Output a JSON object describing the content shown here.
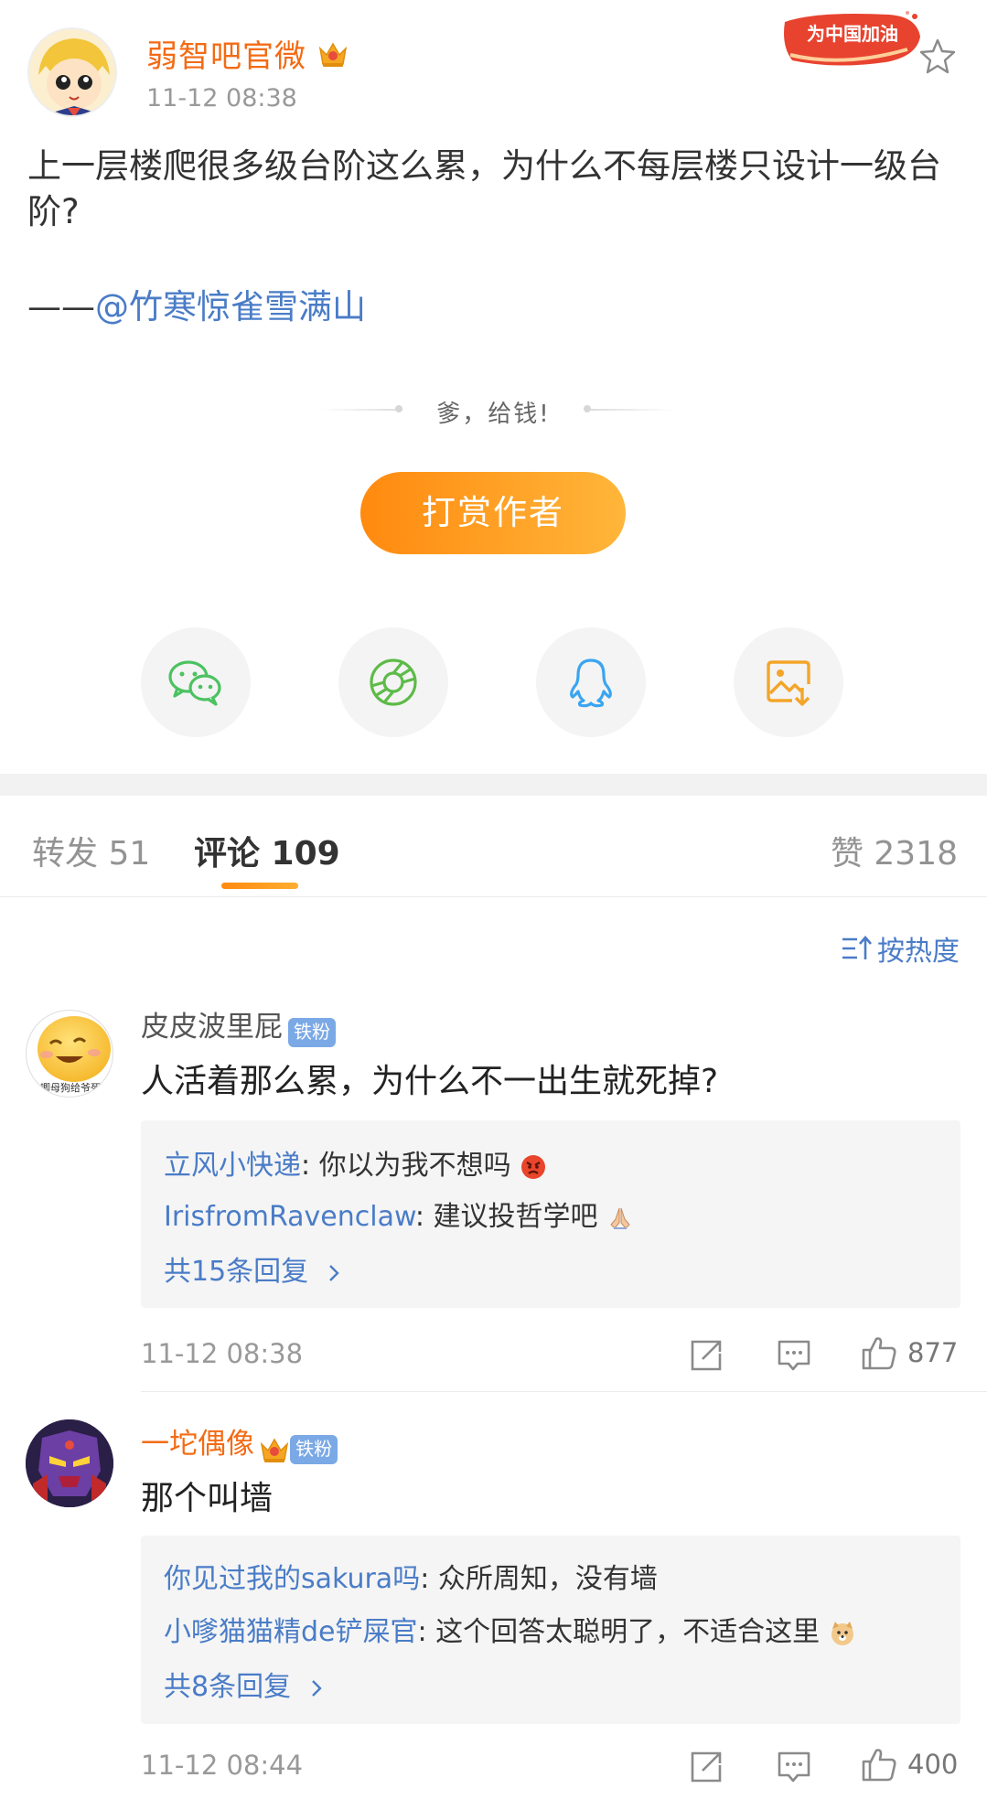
{
  "post": {
    "author": "弱智吧官微",
    "time": "11-12 08:38",
    "campaign_badge": "为中国加油",
    "body": "上一层楼爬很多级台阶这么累，为什么不每层楼只设计一级台阶?",
    "credit_dash": "——",
    "credit_mention": "@竹寒惊雀雪满山",
    "icons": {
      "crown": "crown-icon",
      "star": "star-icon"
    }
  },
  "reward": {
    "prompt": "爹，给钱!",
    "button": "打赏作者"
  },
  "share": [
    {
      "name": "wechat",
      "icon": "wechat-icon",
      "color": "#4cc261"
    },
    {
      "name": "moments",
      "icon": "moments-icon",
      "color": "#5dbb48"
    },
    {
      "name": "qq",
      "icon": "qq-icon",
      "color": "#3aa5f0"
    },
    {
      "name": "save-image",
      "icon": "image-download-icon",
      "color": "#f3a52a"
    }
  ],
  "tabs": {
    "repost": "转发 51",
    "comments": "评论 109",
    "likes": "赞 2318"
  },
  "sort": {
    "label": "按热度",
    "icon": "sort-icon"
  },
  "comments": [
    {
      "name": "皮皮波里屁",
      "badge": "铁粉",
      "avatar_caption": "唧母狗给爷死",
      "text": "人活着那么累，为什么不一出生就死掉?",
      "replies": [
        {
          "name": "立风小快递",
          "text": ": 你以为我不想吗",
          "emoji": "angry-face-icon"
        },
        {
          "name": "IrisfromRavenclaw",
          "text": ": 建议投哲学吧",
          "emoji": "pray-hands-icon"
        }
      ],
      "more": "共15条回复",
      "time": "11-12 08:38",
      "likes": "877"
    },
    {
      "name": "一坨偶像",
      "badge": "铁粉",
      "text": "那个叫墙",
      "replies": [
        {
          "name": "你见过我的sakura吗",
          "text": ": 众所周知，没有墙",
          "emoji": ""
        },
        {
          "name": "小嗲猫猫精de铲屎官",
          "text": ": 这个回答太聪明了，不适合这里",
          "emoji": "doge-icon"
        }
      ],
      "more": "共8条回复",
      "time": "11-12 08:44",
      "likes": "400"
    }
  ],
  "colors": {
    "accent": "#ff8a0f",
    "link": "#4a7cc7",
    "vip_name": "#f36b14"
  }
}
